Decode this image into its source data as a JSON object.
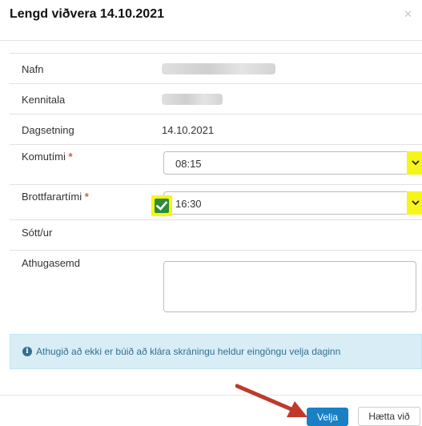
{
  "dialog": {
    "title": "Lengd viðvera 14.10.2021",
    "close_icon": "close-icon"
  },
  "form": {
    "name_label": "Nafn",
    "kennitala_label": "Kennitala",
    "date_label": "Dagsetning",
    "date_value": "14.10.2021",
    "arrival_label": "Komutími",
    "arrival_value": "08:15",
    "departure_label": "Brottfarartími",
    "departure_value": "16:30",
    "required_mark": "*",
    "picked_up_label": "Sótt/ur",
    "picked_up_checked": true,
    "comment_label": "Athugasemd",
    "comment_value": ""
  },
  "alert": {
    "icon": "info-icon",
    "icon_glyph": "i",
    "text": "Athugið að ekki er búið að klára skráningu heldur eingöngu velja daginn"
  },
  "footer": {
    "select_button": "Velja",
    "cancel_button": "Hætta við"
  },
  "colors": {
    "primary": "#1a7fc4",
    "highlight": "#f5f51a",
    "checkbox": "#2e8b37",
    "required": "#d9534f",
    "annotation_arrow": "#c0392b"
  }
}
